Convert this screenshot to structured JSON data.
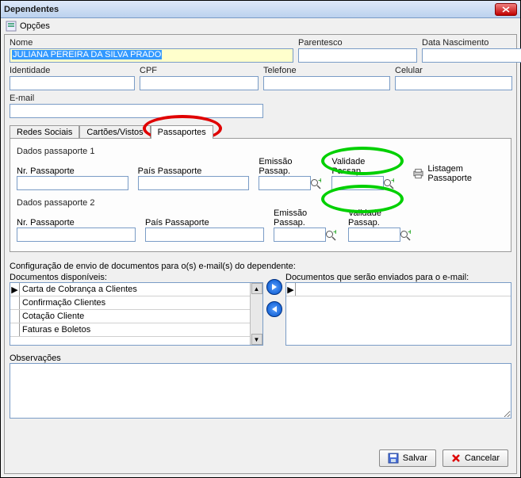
{
  "window": {
    "title": "Dependentes"
  },
  "menu": {
    "opcoes": "Opções"
  },
  "fields": {
    "nome_label": "Nome",
    "nome_value": "JULIANA PEREIRA DA SILVA PRADO",
    "parentesco_label": "Parentesco",
    "parentesco_value": "",
    "datanasc_label": "Data Nascimento",
    "datanasc_value": "",
    "identidade_label": "Identidade",
    "identidade_value": "",
    "cpf_label": "CPF",
    "cpf_value": "",
    "telefone_label": "Telefone",
    "telefone_value": "",
    "celular_label": "Celular",
    "celular_value": "",
    "email_label": "E-mail",
    "email_value": ""
  },
  "tabs": {
    "redes": "Redes Sociais",
    "cartoes": "Cartões/Vistos",
    "passaportes": "Passaportes"
  },
  "passport": {
    "group1": "Dados passaporte 1",
    "group2": "Dados passaporte 2",
    "nr_label": "Nr. Passaporte",
    "pais_label": "País Passaporte",
    "emissao_label": "Emissão Passap.",
    "validade_label": "Validade Passap.",
    "listagem": "Listagem Passaporte",
    "p1": {
      "nr": "",
      "pais": "",
      "emissao": "",
      "validade": ""
    },
    "p2": {
      "nr": "",
      "pais": "",
      "emissao": "",
      "validade": ""
    }
  },
  "config": {
    "title": "Configuração de envio de documentos para o(s) e-mail(s) do dependente:",
    "disponiveis_label": "Documentos disponíveis:",
    "enviados_label": "Documentos que serão enviados para o e-mail:",
    "disponiveis": [
      "Carta de Cobrança a Clientes",
      "Confirmação Clientes",
      "Cotação Cliente",
      "Faturas e Boletos"
    ]
  },
  "observ": {
    "label": "Observações",
    "value": ""
  },
  "buttons": {
    "salvar": "Salvar",
    "cancelar": "Cancelar"
  }
}
